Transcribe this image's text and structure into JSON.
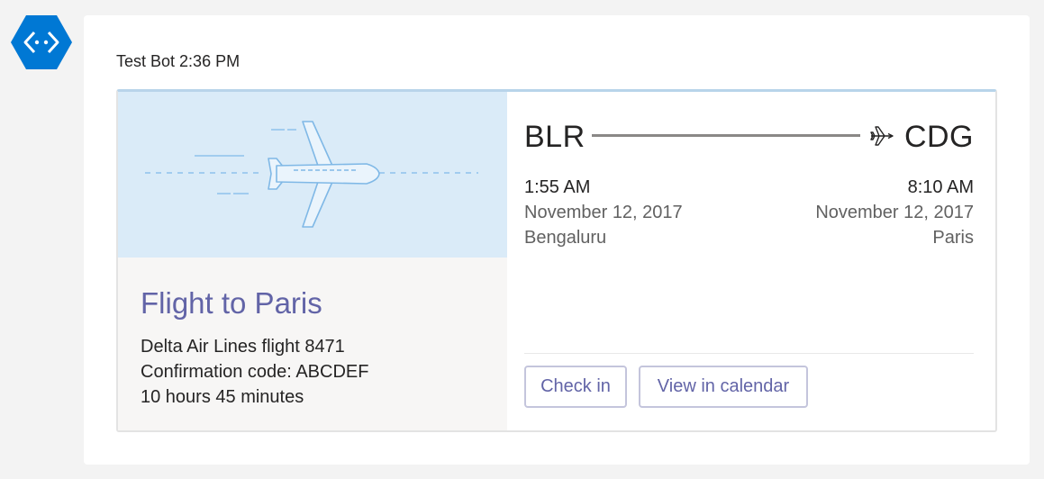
{
  "bot": {
    "avatar_icon": "bot-hexagon-icon",
    "sender": "Test Bot",
    "time": "2:36 PM"
  },
  "card": {
    "hero_icon": "airplane-illustration",
    "title": "Flight to Paris",
    "airline_line": "Delta Air Lines flight 8471",
    "confirmation_line": "Confirmation code: ABCDEF",
    "duration_line": "10 hours 45 minutes",
    "origin": {
      "code": "BLR",
      "time": "1:55 AM",
      "date": "November 12, 2017",
      "city": "Bengaluru"
    },
    "destination": {
      "code": "CDG",
      "time": "8:10 AM",
      "date": "November 12, 2017",
      "city": "Paris"
    },
    "route_icon": "airplane-icon",
    "actions": {
      "check_in": "Check in",
      "view_calendar": "View in calendar"
    }
  },
  "colors": {
    "accent": "#6264a7",
    "avatar": "#0078d4",
    "hero_bg": "#daebf8",
    "card_top_border": "#b8d4ea"
  }
}
